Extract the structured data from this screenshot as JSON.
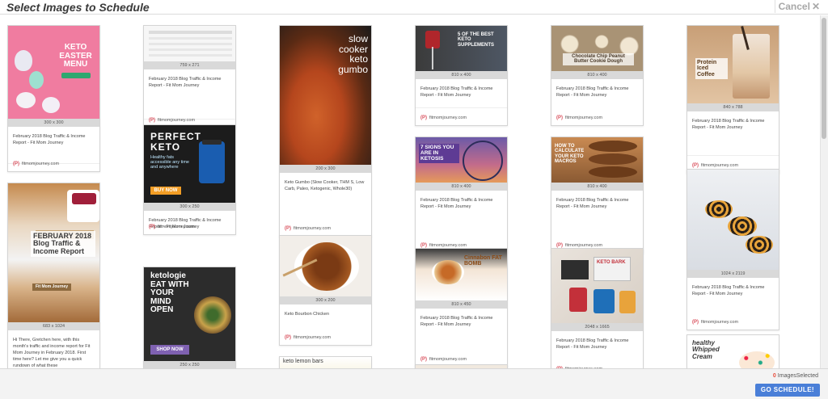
{
  "header": {
    "title": "Select Images to Schedule",
    "cancel_label": "Cancel",
    "close_glyph": "✕"
  },
  "source_label": "fitmomjourney.com",
  "source_icon": "pinterest-icon",
  "cards": [
    {
      "id": "c1",
      "thumb_text": "KETO EASTER MENU",
      "dimensions": "300 x 300",
      "description": "February 2018 Blog Traffic & Income Report - Fit Mom Journey"
    },
    {
      "id": "c2",
      "thumb_text": "",
      "dimensions": "759 x 271",
      "description": "February 2018 Blog Traffic & Income Report - Fit Mom Journey"
    },
    {
      "id": "c3",
      "thumb_text": "slow cooker keto gumbo",
      "dimensions": "200 x 300",
      "description": "Keto Gumbo (Slow Cooker, THM S, Low Carb, Paleo, Ketogenic, Whole30)"
    },
    {
      "id": "c4",
      "thumb_text": "5 OF THE BEST KETO SUPPLEMENTS",
      "dimensions": "810 x 400",
      "description": "February 2018 Blog Traffic & Income Report - Fit Mom Journey"
    },
    {
      "id": "c5",
      "thumb_text": "Chocolate Chip Peanut Butter Cookie Dough",
      "dimensions": "810 x 400",
      "description": "February 2018 Blog Traffic & Income Report - Fit Mom Journey"
    },
    {
      "id": "c6",
      "thumb_text": "Protein Iced Coffee",
      "dimensions": "840 x 788",
      "description": "February 2018 Blog Traffic & Income Report - Fit Mom Journey"
    },
    {
      "id": "c7",
      "thumb_text": "PERFECT KETO",
      "thumb_sub": "Healthy fats accessible any time and anywhere",
      "thumb_btn": "BUY NOW",
      "dimensions": "300 x 250",
      "description": "February 2018 Blog Traffic & Income Report - Fit Mom Journey"
    },
    {
      "id": "c8",
      "thumb_text": "7 SIGNS YOU ARE IN KETOSIS",
      "dimensions": "810 x 400",
      "description": "February 2018 Blog Traffic & Income Report - Fit Mom Journey"
    },
    {
      "id": "c9",
      "thumb_text": "HOW TO CALCULATE YOUR KETO MACROS",
      "dimensions": "810 x 400",
      "description": "February 2018 Blog Traffic & Income Report - Fit Mom Journey"
    },
    {
      "id": "c10",
      "thumb_text": "FEBRUARY 2018 Blog Traffic & Income Report",
      "thumb_sub": "Fit Mom Journey",
      "dimensions": "683 x 1024",
      "description": "Hi There, Gretchen here, with this month's traffic and income report for Fit Mom Journey in February 2018. First time here? Let me give you a quick rundown of what these"
    },
    {
      "id": "c11",
      "thumb_text": "Keto Bourbon Chicken",
      "dimensions": "300 x 200",
      "description": "Keto Bourbon Chicken"
    },
    {
      "id": "c12",
      "thumb_text": "Cinnabon FAT BOMB",
      "dimensions": "810 x 450",
      "description": "February 2018 Blog Traffic & Income Report - Fit Mom Journey"
    },
    {
      "id": "c13",
      "thumb_text": "KETO BARK",
      "dimensions": "2048 x 1665",
      "description": "February 2018 Blog Traffic & Income Report - Fit Mom Journey"
    },
    {
      "id": "c14",
      "thumb_text": "",
      "dimensions": "1024 x 2119",
      "description": "February 2018 Blog Traffic & Income Report - Fit Mom Journey"
    },
    {
      "id": "c15",
      "thumb_text": "ketologie EAT WITH YOUR MIND OPEN",
      "thumb_btn": "SHOP NOW",
      "dimensions": "250 x 250",
      "description": ""
    },
    {
      "id": "c16",
      "thumb_text": "keto lemon bars",
      "dimensions": "",
      "description": ""
    },
    {
      "id": "c17",
      "thumb_text": "healthy Whipped Cream",
      "dimensions": "",
      "description": ""
    }
  ],
  "footer": {
    "selected_count": "0",
    "selected_label": "ImagesSelected",
    "go_label": "GO SCHEDULE!"
  },
  "colors": {
    "accent": "#4a7fd8",
    "count": "#e74c3c"
  }
}
